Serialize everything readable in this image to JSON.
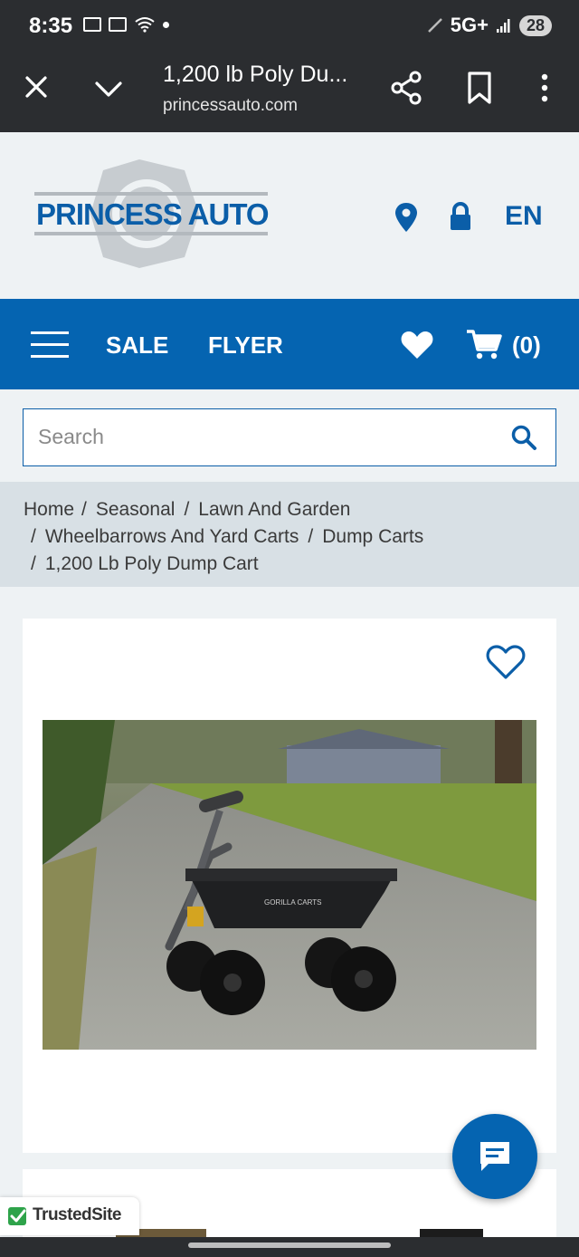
{
  "status_bar": {
    "time": "8:35",
    "network": "5G+",
    "battery": "28"
  },
  "browser": {
    "title": "1,200 lb Poly Du...",
    "url": "princessauto.com"
  },
  "header": {
    "logo_text": "PRINCESS AUTO",
    "language": "EN"
  },
  "nav": {
    "sale": "SALE",
    "flyer": "FLYER",
    "cart_count": "(0)"
  },
  "search": {
    "placeholder": "Search"
  },
  "breadcrumb": {
    "items": [
      "Home",
      "Seasonal",
      "Lawn And Garden",
      "Wheelbarrows And Yard Carts",
      "Dump Carts",
      "1,200 Lb Poly Dump Cart"
    ]
  },
  "product": {
    "cart_brand": "GORILLA CARTS"
  },
  "trusted": {
    "text": "TrustedSite"
  },
  "colors": {
    "brand_blue": "#0564b1",
    "header_bg": "#eef2f4",
    "breadcrumb_bg": "#d8e0e5",
    "trusted_green": "#2ea34a"
  }
}
